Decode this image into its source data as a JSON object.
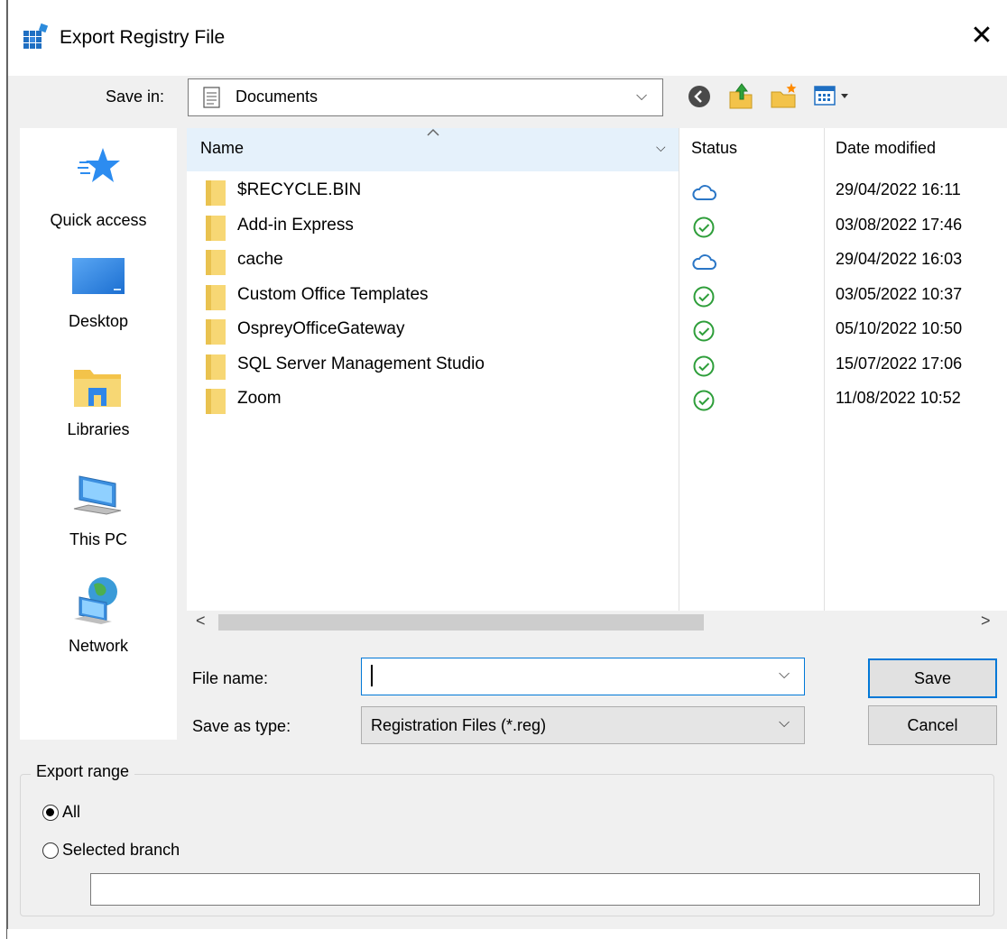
{
  "window": {
    "title": "Export Registry File"
  },
  "toolbar": {
    "save_in_label": "Save in:",
    "location": "Documents",
    "icons": [
      "back-icon",
      "up-folder-icon",
      "new-folder-icon",
      "view-menu-icon"
    ]
  },
  "places": [
    {
      "label": "Quick access",
      "icon": "quick-access-star-icon"
    },
    {
      "label": "Desktop",
      "icon": "desktop-icon"
    },
    {
      "label": "Libraries",
      "icon": "libraries-icon"
    },
    {
      "label": "This PC",
      "icon": "this-pc-icon"
    },
    {
      "label": "Network",
      "icon": "network-icon"
    }
  ],
  "filelist": {
    "columns": {
      "name": "Name",
      "status": "Status",
      "date": "Date modified"
    },
    "sort_indicator": "^",
    "rows": [
      {
        "name": "$RECYCLE.BIN",
        "status": "cloud",
        "date": "29/04/2022 16:11"
      },
      {
        "name": "Add-in Express",
        "status": "synced",
        "date": "03/08/2022 17:46"
      },
      {
        "name": "cache",
        "status": "cloud",
        "date": "29/04/2022 16:03"
      },
      {
        "name": "Custom Office Templates",
        "status": "synced",
        "date": "03/05/2022 10:37"
      },
      {
        "name": "OspreyOfficeGateway",
        "status": "synced",
        "date": "05/10/2022 10:50"
      },
      {
        "name": "SQL Server Management Studio",
        "status": "synced",
        "date": "15/07/2022 17:06"
      },
      {
        "name": "Zoom",
        "status": "synced",
        "date": "11/08/2022 10:52"
      }
    ],
    "scroll_left": "<",
    "scroll_right": ">"
  },
  "form": {
    "file_name_label": "File name:",
    "file_name_value": "",
    "save_as_type_label": "Save as type:",
    "save_as_type_value": "Registration Files (*.reg)"
  },
  "buttons": {
    "save": "Save",
    "cancel": "Cancel"
  },
  "export_range": {
    "title": "Export range",
    "options": [
      {
        "label": "All",
        "selected": true
      },
      {
        "label": "Selected branch",
        "selected": false
      }
    ],
    "branch_value": ""
  },
  "colors": {
    "accent": "#0078d7",
    "header_bg": "#e5f1fb",
    "folder": "#f7d774",
    "synced_green": "#2e9e3a",
    "cloud_blue": "#2a76c6",
    "dialog_bg": "#f0f0f0"
  }
}
